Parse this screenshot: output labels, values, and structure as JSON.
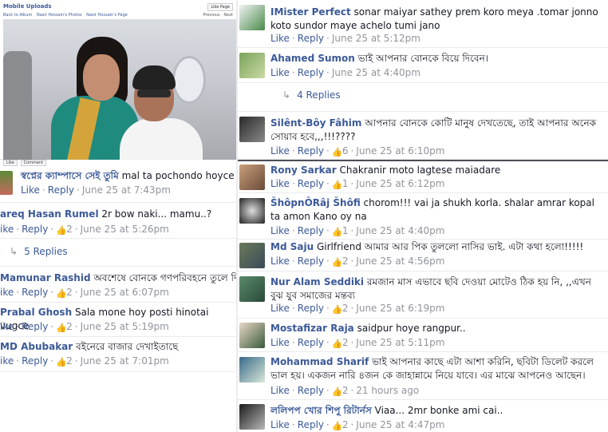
{
  "photo": {
    "title": "Mobile Uploads",
    "breadcrumbs": [
      "Back to Album",
      "Nasir Hossain's Photos",
      "Nasir Hossain's Page"
    ],
    "like_page": "Like Page",
    "prev_next": "Previous · Next",
    "actions": [
      "Like",
      "Comment"
    ]
  },
  "left_comments": [
    {
      "name": "স্বপ্নের ক্যাম্পাসে সেই তুমি",
      "text": "mal ta pochondo hoyce",
      "like": "Like",
      "reply": "Reply",
      "likes": "",
      "time": "June 25 at 7:43pm"
    },
    {
      "name": "areq Hasan Rumel",
      "text": "2r bow naki... mamu..?",
      "like": "ike",
      "reply": "Reply",
      "likes": "2",
      "time": "June 25 at 5:26pm"
    },
    {
      "name": "Mamunar Rashid",
      "text": "অবশেষে বোনকে গণপরিবহনে তুলে দিলা।।",
      "like": "ike",
      "reply": "Reply",
      "likes": "2",
      "time": "June 25 at 6:07pm"
    },
    {
      "name": "Prabal Ghosh",
      "text": "Sala mone hoy posti hinotai vugce",
      "like": "ike",
      "reply": "Reply",
      "likes": "2",
      "time": "June 25 at 5:19pm"
    },
    {
      "name": "MD Abubakar",
      "text": "বইনেরে বাজার দেখাইতাছে",
      "like": "ike",
      "reply": "Reply",
      "likes": "2",
      "time": "June 25 at 7:01pm"
    }
  ],
  "left_replies": "5 Replies",
  "right_comments": [
    {
      "name": "IMister Perfect",
      "text": "sonar maiyar sathey prem koro meya .tomar jonno koto sundor maye achelo tumi jano",
      "like": "Like",
      "reply": "Reply",
      "likes": "",
      "time": "June 25 at 5:12pm"
    },
    {
      "name": "Ahamed Sumon",
      "text": "ভাই আপনার বোনকে বিয়ে দিবেন।",
      "like": "Like",
      "reply": "Reply",
      "likes": "",
      "time": "June 25 at 4:40pm"
    },
    {
      "name": "Silênt-Bôy Fâhim",
      "text": "আপনার বোনকে কোটি মানুষ দেখতেছে, তাই আপনার অনেক সোয়াব হবে,,,!!!????",
      "like": "Like",
      "reply": "Reply",
      "likes": "6",
      "time": "June 25 at 6:10pm"
    },
    {
      "name": "Rony Sarkar",
      "text": "Chakranir moto lagtese maiadare",
      "like": "Like",
      "reply": "Reply",
      "likes": "1",
      "time": "June 25 at 6:12pm"
    },
    {
      "name": "ŠhôpnÔRâj Šhôfi",
      "text": "chorom!!! vai ja shukh korla. shalar amrar kopal ta amon Kano oy na",
      "like": "Like",
      "reply": "Reply",
      "likes": "1",
      "time": "June 25 at 4:40pm"
    },
    {
      "name": "Md Saju",
      "text": "Girlfriend আমার আর পিক তুললো নাসির ভাই. এটা কথা হলো!!!!!",
      "like": "Like",
      "reply": "Reply",
      "likes": "2",
      "time": "June 25 at 4:56pm"
    },
    {
      "name": "Nur Alam Seddiki",
      "text": "রমজান মাস এভাবে ছবি দেওয়া মোটেও ঠিক হয় নি, ,,এখন বুঝ যুব সমাজের মন্তব্য",
      "like": "Like",
      "reply": "Reply",
      "likes": "2",
      "time": "June 25 at 6:19pm"
    },
    {
      "name": "Mostafizar Raja",
      "text": "saidpur hoye rangpur..",
      "like": "Like",
      "reply": "Reply",
      "likes": "2",
      "time": "June 25 at 5:11pm"
    },
    {
      "name": "Mohammad Sharif",
      "text": "ভাই আপনার কাছে এটা আশা করিনি, ছবিটা ডিলেট করলে ভাল হয়। একজন নারি ৪জন কে জাহান্নামে নিয়ে যাবে। এর মাঝে আপনেও আছেন।",
      "like": "Like",
      "reply": "Reply",
      "likes": "2",
      "time": "21 hours ago"
    },
    {
      "name": "ললিপপ খোর শিপু রিটার্নস",
      "text": "Viaa... 2mr bonke ami cai..",
      "like": "Like",
      "reply": "Reply",
      "likes": "2",
      "time": "June 25 at 4:47pm"
    }
  ],
  "right_replies": "4 Replies",
  "colors": {
    "link": "#3b5998",
    "meta": "#90949c",
    "thumb": "#5890ff"
  }
}
